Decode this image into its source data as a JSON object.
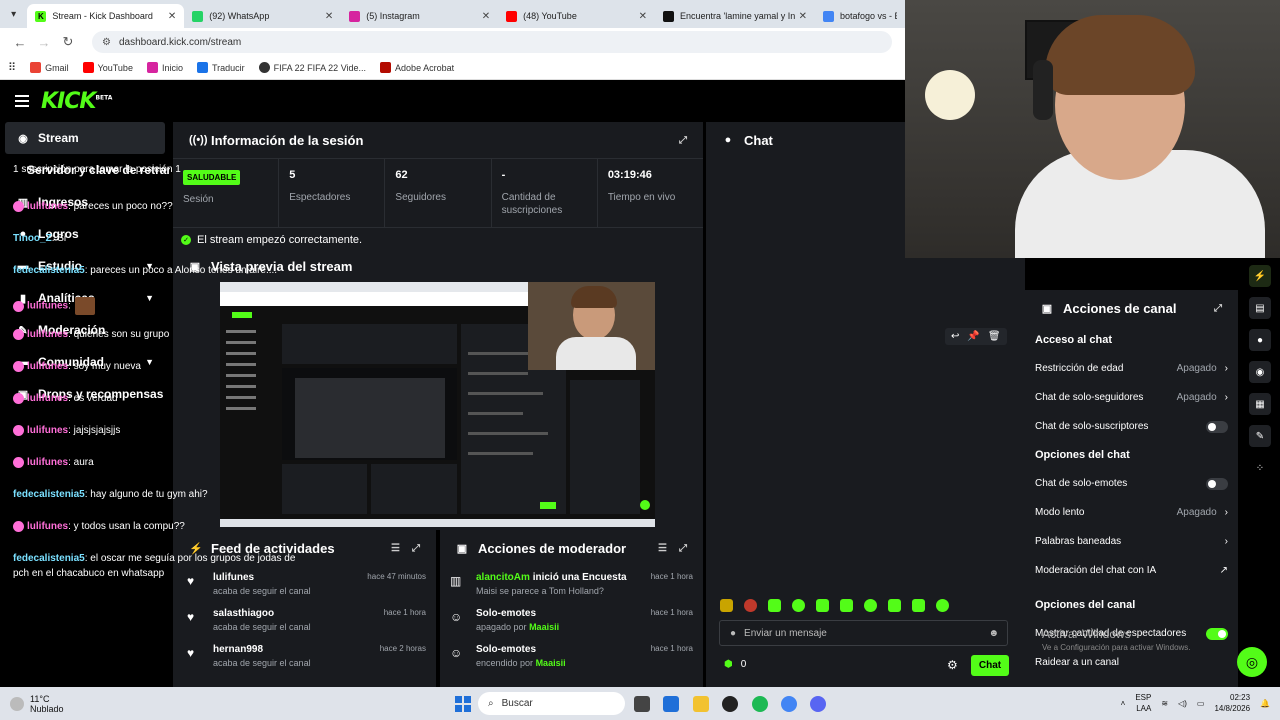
{
  "browser": {
    "tabs": [
      {
        "title": "Stream - Kick Dashboard",
        "color": "#53fc18",
        "active": true
      },
      {
        "title": "(92) WhatsApp",
        "color": "#25d366",
        "active": false
      },
      {
        "title": "(5) Instagram",
        "color": "#d6249f",
        "active": false
      },
      {
        "title": "(48) YouTube",
        "color": "#ff0000",
        "active": false
      },
      {
        "title": "Encuentra 'lamine yamal y Inés",
        "color": "#111111",
        "active": false
      },
      {
        "title": "botafogo vs - Bus",
        "color": "#4285f4",
        "active": false
      }
    ],
    "url": "dashboard.kick.com/stream",
    "bookmarks": [
      "Gmail",
      "YouTube",
      "Inicio",
      "Traducir",
      "FIFA 22 FIFA 22 Vide...",
      "Adobe Acrobat"
    ]
  },
  "header": {
    "logo": "KICK",
    "logo_sup": "BETA"
  },
  "sidebar": {
    "items": [
      {
        "label": "Stream",
        "icon": "broadcast-icon",
        "active": true
      },
      {
        "label": "Servidor y clave de retransmisión",
        "sub": true
      },
      {
        "label": "Ingresos",
        "icon": "chart-icon"
      },
      {
        "label": "Logros",
        "icon": "trophy-icon"
      },
      {
        "label": "Estudio",
        "icon": "studio-icon",
        "expand": true
      },
      {
        "label": "Analíticas",
        "icon": "analytics-icon",
        "expand": true
      },
      {
        "label": "Moderación",
        "icon": "hammer-icon"
      },
      {
        "label": "Comunidad",
        "icon": "community-icon",
        "expand": true
      },
      {
        "label": "Drops y recompensas",
        "icon": "gift-icon"
      }
    ]
  },
  "session": {
    "title": "Información de la sesión",
    "status_badge": "SALUDABLE",
    "status_label": "Sesión",
    "stats": [
      {
        "value": "5",
        "label": "Espectadores"
      },
      {
        "value": "62",
        "label": "Seguidores"
      },
      {
        "value": "-",
        "label": "Cantidad de suscripciones"
      },
      {
        "value": "03:19:46",
        "label": "Tiempo en vivo"
      }
    ],
    "ok_message": "El stream empezó correctamente."
  },
  "preview": {
    "title": "Vista previa del stream"
  },
  "feed": {
    "title": "Feed de actividades",
    "items": [
      {
        "name": "lulifunes",
        "sub": "acaba de seguir el canal",
        "time": "hace 47 minutos"
      },
      {
        "name": "salasthiagoo",
        "sub": "acaba de seguir el canal",
        "time": "hace 1 hora"
      },
      {
        "name": "hernan998",
        "sub": "acaba de seguir el canal",
        "time": "hace 2 horas"
      }
    ]
  },
  "modactions": {
    "title": "Acciones de moderador",
    "items": [
      {
        "user": "alancitoAm",
        "action": "inició una Encuesta",
        "sub": "Maisi se parece a Tom Holland?",
        "time": "hace 1 hora"
      },
      {
        "user": "",
        "action": "Solo-emotes",
        "sub_pre": "apagado por",
        "sub_user": "Maaisii",
        "time": "hace 1 hora"
      },
      {
        "user": "",
        "action": "Solo-emotes",
        "sub_pre": "encendido por",
        "sub_user": "Maaisii",
        "time": "hace 1 hora"
      }
    ]
  },
  "chat": {
    "title": "Chat",
    "pinned": "1 suscripción para tomar la posición 1",
    "messages": [
      {
        "user": "lulifunes",
        "text": ": pareces un poco no??",
        "color": "pink"
      },
      {
        "user": "Tinoo_Z",
        "text": ": Si",
        "color": "cyan"
      },
      {
        "user": "fedecalistenia5",
        "text": ": pareces un poco a Alonso tenes un aire....",
        "color": "cyan"
      },
      {
        "user": "lulifunes",
        "text": ":",
        "color": "pink"
      },
      {
        "user": "lulifunes",
        "text": ": quienes son su grupo",
        "color": "pink"
      },
      {
        "user": "lulifunes",
        "text": ": soy muy nueva",
        "color": "pink"
      },
      {
        "user": "lulifunes",
        "text": ": es verdad",
        "color": "pink"
      },
      {
        "user": "lulifunes",
        "text": ": jajsjsjajsjjs",
        "color": "pink"
      },
      {
        "user": "lulifunes",
        "text": ": aura",
        "color": "pink"
      },
      {
        "user": "fedecalistenia5",
        "text": ": hay alguno de tu gym ahi?",
        "color": "cyan"
      },
      {
        "user": "lulifunes",
        "text": ": y todos usan la compu??",
        "color": "pink"
      },
      {
        "user": "fedecalistenia5",
        "text": ": el oscar me seguía por los grupos de jodas de",
        "color": "cyan"
      },
      {
        "user": "",
        "text": "pch en el chacabuco en whatsapp",
        "color": "cyan"
      }
    ],
    "input_placeholder": "Enviar un mensaje",
    "points": "0",
    "send_label": "Chat"
  },
  "channel_actions": {
    "title": "Acciones de canal",
    "sections": [
      {
        "heading": "Acceso al chat",
        "rows": [
          {
            "label": "Restricción de edad",
            "value": "Apagado",
            "type": "select"
          },
          {
            "label": "Chat de solo-seguidores",
            "value": "Apagado",
            "type": "select"
          },
          {
            "label": "Chat de solo-suscriptores",
            "type": "toggle",
            "on": false
          }
        ]
      },
      {
        "heading": "Opciones del chat",
        "rows": [
          {
            "label": "Chat de solo-emotes",
            "type": "toggle",
            "on": false
          },
          {
            "label": "Modo lento",
            "value": "Apagado",
            "type": "select"
          },
          {
            "label": "Palabras baneadas",
            "type": "link"
          },
          {
            "label": "Moderación del chat con IA",
            "type": "external"
          }
        ]
      },
      {
        "heading": "Opciones del canal",
        "rows": [
          {
            "label": "Mostrar cantidad de espectadores",
            "type": "toggle",
            "on": true
          },
          {
            "label": "Raidear a un canal",
            "type": "plain"
          }
        ]
      }
    ]
  },
  "windows_notice": {
    "title": "Activar Windows",
    "sub": "Ve a Configuración para activar Windows."
  },
  "taskbar": {
    "temp": "11°C",
    "weather": "Nublado",
    "search": "Buscar",
    "lang1": "ESP",
    "lang2": "LAA",
    "time": "02:23",
    "date": "14/8/2026"
  }
}
